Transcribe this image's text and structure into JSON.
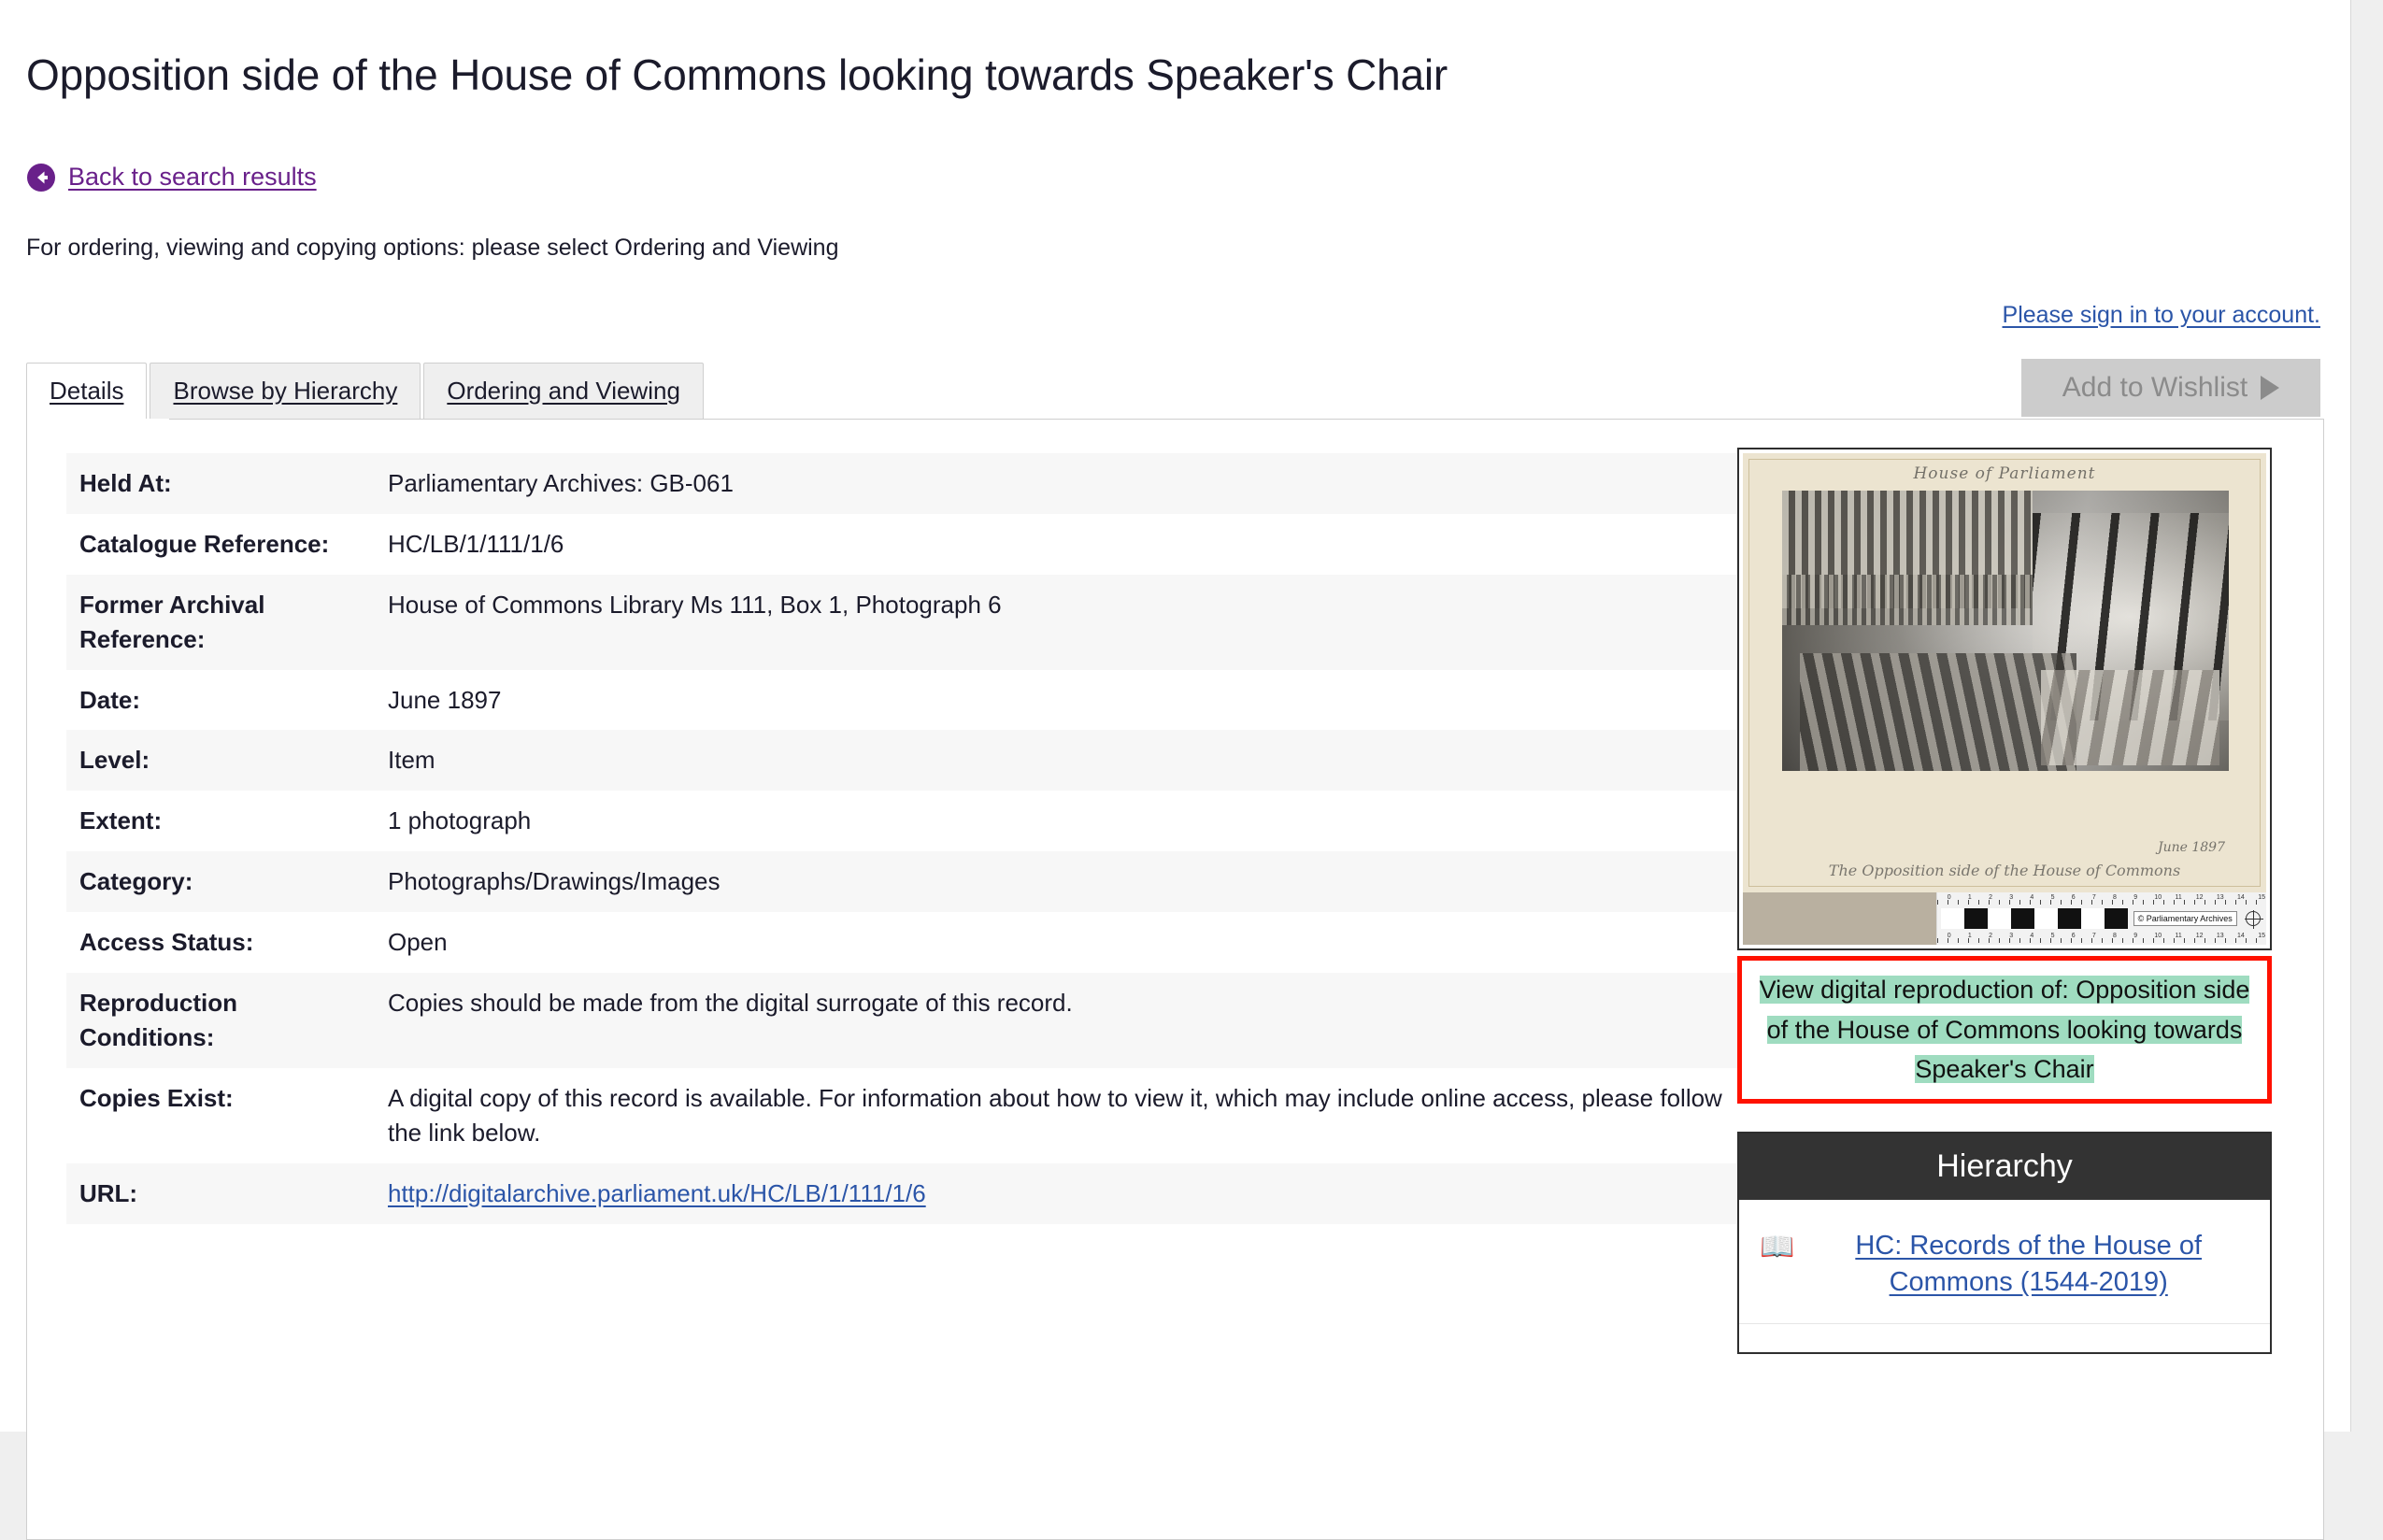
{
  "header": {
    "title": "Opposition side of the House of Commons looking towards Speaker's Chair",
    "back_link": "Back to search results",
    "back_icon": "arrow-left-circle-icon",
    "note": "For ordering, viewing and copying options: please select Ordering and Viewing",
    "signin_link": "Please sign in to your account."
  },
  "tabs": [
    {
      "label": "Details",
      "active": true
    },
    {
      "label": "Browse by Hierarchy",
      "active": false
    },
    {
      "label": "Ordering and Viewing",
      "active": false
    }
  ],
  "wishlist": {
    "label": "Add to Wishlist",
    "icon": "play-triangle-icon",
    "disabled": true
  },
  "details": [
    {
      "label": "Held At:",
      "value": "Parliamentary Archives: GB-061"
    },
    {
      "label": "Catalogue Reference:",
      "value": "HC/LB/1/111/1/6"
    },
    {
      "label": "Former Archival Reference:",
      "value": "House of Commons Library Ms 111, Box 1, Photograph 6"
    },
    {
      "label": "Date:",
      "value": "June 1897"
    },
    {
      "label": "Level:",
      "value": "Item"
    },
    {
      "label": "Extent:",
      "value": "1 photograph"
    },
    {
      "label": "Category:",
      "value": "Photographs/Drawings/Images"
    },
    {
      "label": "Access Status:",
      "value": "Open"
    },
    {
      "label": "Reproduction Conditions:",
      "value": "Copies should be made from the digital surrogate of this record."
    },
    {
      "label": "Copies Exist:",
      "value": "A digital copy of this record is available. For information about how to view it, which may include online access, please follow the link below."
    },
    {
      "label": "URL:",
      "value": "http://digitalarchive.parliament.uk/HC/LB/1/111/1/6",
      "is_link": true
    }
  ],
  "image_panel": {
    "photo_title": "House of Parliament",
    "photo_caption": "The Opposition side of the House of Commons",
    "photo_date": "June 1897",
    "ruler_copyright": "© Parliamentary Archives",
    "ruler_units": "cm",
    "ruler_ticks": [
      "0",
      "1",
      "2",
      "3",
      "4",
      "5",
      "6",
      "7",
      "8",
      "9",
      "10",
      "11",
      "12",
      "13",
      "14",
      "15"
    ],
    "caption": "View digital reproduction of: Opposition side of the House of Commons looking towards Speaker's Chair",
    "caption_highlight_color": "#9fdcc0",
    "caption_border_color": "#ff1100"
  },
  "hierarchy": {
    "title": "Hierarchy",
    "items": [
      {
        "icon": "book-icon",
        "label": "HC: Records of the House of Commons (1544-2019)"
      },
      {
        "icon": "book-icon",
        "label": ""
      }
    ]
  },
  "colors": {
    "accent_purple": "#69208a",
    "link_blue": "#2b55a8",
    "row_alt": "#f7f7f7",
    "tab_inactive": "#efefef",
    "hierarchy_header": "#333333"
  }
}
